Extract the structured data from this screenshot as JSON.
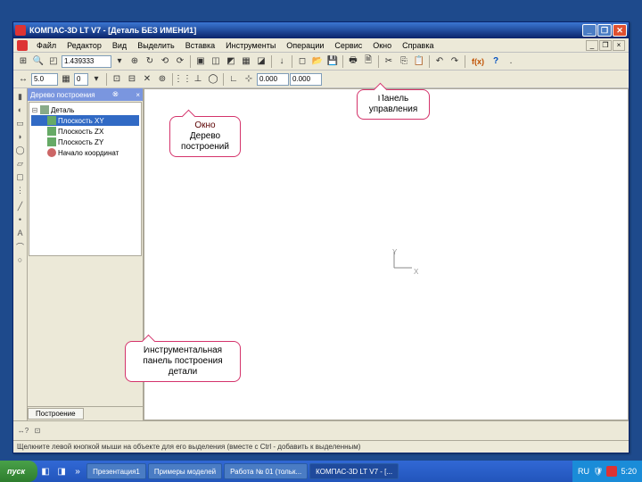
{
  "window": {
    "title": "КОМПАС-3D LT V7 - [Деталь БЕЗ ИМЕНИ1]"
  },
  "menu": {
    "file": "Файл",
    "editor": "Редактор",
    "view": "Вид",
    "select": "Выделить",
    "insert": "Вставка",
    "tools": "Инструменты",
    "ops": "Операции",
    "service": "Сервис",
    "window": "Окно",
    "help": "Справка"
  },
  "toolbar": {
    "zoom_value": "1.439333",
    "step_value": "5.0",
    "count_value": "0",
    "coord_x": "0.000",
    "coord_y": "0.000",
    "fx": "f(x)"
  },
  "tree": {
    "title": "Дерево построения",
    "root": "Деталь",
    "items": [
      "Плоскость XY",
      "Плоскость ZX",
      "Плоскость ZY",
      "Начало координат"
    ],
    "tab": "Построение"
  },
  "axes": {
    "x": "X",
    "y": "Y"
  },
  "callouts": {
    "tree_label_1": "Окно",
    "tree_label_2": "Дерево",
    "tree_label_3": "построений",
    "panel_label_1": "Панель",
    "panel_label_2": "управления",
    "tools_label_1": "Инструментальная",
    "tools_label_2": "панель построения",
    "tools_label_3": "детали"
  },
  "status": {
    "hint": "Щелкните левой кнопкой мыши на объекте для его выделения (вместе с Ctrl - добавить к выделенным)"
  },
  "taskbar": {
    "start": "пуск",
    "items": [
      "Презентация1",
      "Примеры моделей",
      "Работа № 01 (тольк...",
      "КОМПАС-3D LT V7 - [..."
    ],
    "lang": "RU",
    "time": "5:20"
  }
}
